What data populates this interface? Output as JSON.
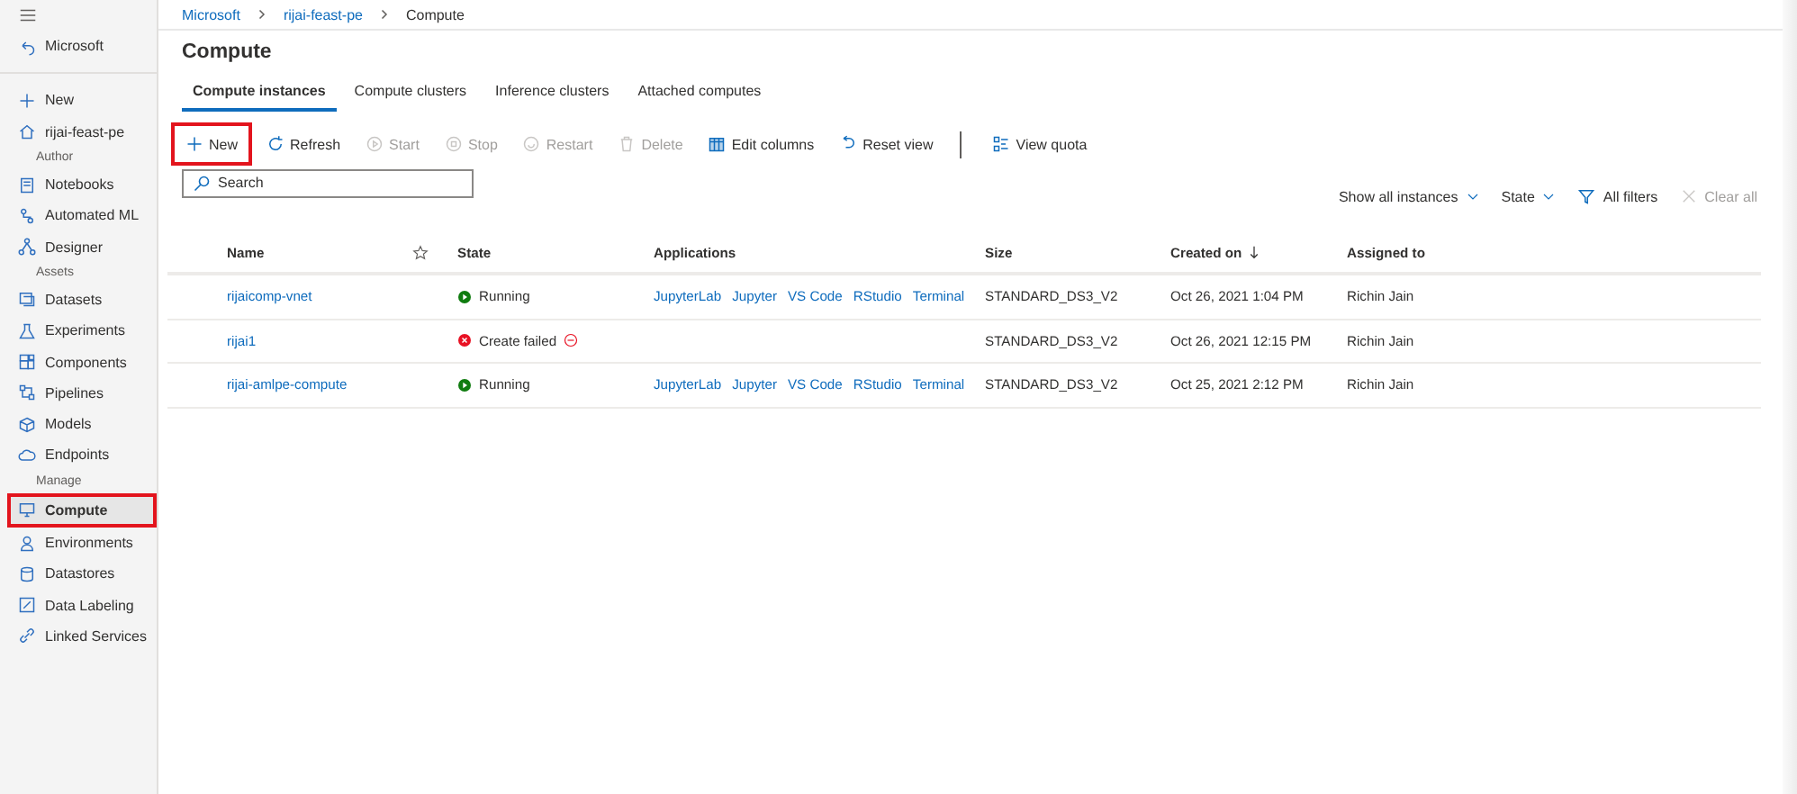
{
  "sidebar": {
    "back": "Microsoft",
    "items": [
      {
        "kind": "item",
        "label": "New",
        "selected": false,
        "highlighted": false
      },
      {
        "kind": "item",
        "label": "rijai-feast-pe",
        "selected": false,
        "highlighted": false
      },
      {
        "kind": "section",
        "label": "Author"
      },
      {
        "kind": "item",
        "label": "Notebooks",
        "selected": false,
        "highlighted": false
      },
      {
        "kind": "item",
        "label": "Automated ML",
        "selected": false,
        "highlighted": false
      },
      {
        "kind": "item",
        "label": "Designer",
        "selected": false,
        "highlighted": false
      },
      {
        "kind": "section",
        "label": "Assets"
      },
      {
        "kind": "item",
        "label": "Datasets",
        "selected": false,
        "highlighted": false
      },
      {
        "kind": "item",
        "label": "Experiments",
        "selected": false,
        "highlighted": false
      },
      {
        "kind": "item",
        "label": "Components",
        "selected": false,
        "highlighted": false
      },
      {
        "kind": "item",
        "label": "Pipelines",
        "selected": false,
        "highlighted": false
      },
      {
        "kind": "item",
        "label": "Models",
        "selected": false,
        "highlighted": false
      },
      {
        "kind": "item",
        "label": "Endpoints",
        "selected": false,
        "highlighted": false
      },
      {
        "kind": "section",
        "label": "Manage"
      },
      {
        "kind": "item",
        "label": "Compute",
        "selected": true,
        "highlighted": true
      },
      {
        "kind": "item",
        "label": "Environments",
        "selected": false,
        "highlighted": false
      },
      {
        "kind": "item",
        "label": "Datastores",
        "selected": false,
        "highlighted": false
      },
      {
        "kind": "item",
        "label": "Data Labeling",
        "selected": false,
        "highlighted": false
      },
      {
        "kind": "item",
        "label": "Linked Services",
        "selected": false,
        "highlighted": false
      }
    ]
  },
  "breadcrumb": [
    "Microsoft",
    "rijai-feast-pe",
    "Compute"
  ],
  "title": "Compute",
  "tabs": [
    {
      "label": "Compute instances",
      "selected": true
    },
    {
      "label": "Compute clusters",
      "selected": false
    },
    {
      "label": "Inference clusters",
      "selected": false
    },
    {
      "label": "Attached computes",
      "selected": false
    }
  ],
  "toolbar": [
    {
      "label": "New",
      "disabled": false,
      "highlighted": true
    },
    {
      "label": "Refresh",
      "disabled": false,
      "highlighted": false
    },
    {
      "label": "Start",
      "disabled": true,
      "highlighted": false
    },
    {
      "label": "Stop",
      "disabled": true,
      "highlighted": false
    },
    {
      "label": "Restart",
      "disabled": true,
      "highlighted": false
    },
    {
      "label": "Delete",
      "disabled": true,
      "highlighted": false
    },
    {
      "label": "Edit columns",
      "disabled": false,
      "highlighted": false
    },
    {
      "label": "Reset view",
      "disabled": false,
      "highlighted": false
    },
    {
      "label": "View quota",
      "disabled": false,
      "highlighted": false
    }
  ],
  "search": {
    "placeholder": "Search"
  },
  "filters": [
    {
      "label": "Show all instances",
      "kind": "dropdown",
      "disabled": false
    },
    {
      "label": "State",
      "kind": "dropdown",
      "disabled": false
    },
    {
      "label": "All filters",
      "kind": "filter",
      "disabled": false
    },
    {
      "label": "Clear all",
      "kind": "clear",
      "disabled": true
    }
  ],
  "table": {
    "columns": [
      "Name",
      "State",
      "Applications",
      "Size",
      "Created on",
      "Assigned to"
    ],
    "rows": [
      {
        "name": "rijaicomp-vnet",
        "state": "Running",
        "kind": "running",
        "applications": [
          "JupyterLab",
          "Jupyter",
          "VS Code",
          "RStudio",
          "Terminal"
        ],
        "size": "STANDARD_DS3_V2",
        "created": "Oct 26, 2021 1:04 PM",
        "assigned": "Richin Jain"
      },
      {
        "name": "rijai1",
        "state": "Create failed",
        "kind": "failed",
        "applications": [],
        "size": "STANDARD_DS3_V2",
        "created": "Oct 26, 2021 12:15 PM",
        "assigned": "Richin Jain"
      },
      {
        "name": "rijai-amlpe-compute",
        "state": "Running",
        "kind": "running",
        "applications": [
          "JupyterLab",
          "Jupyter",
          "VS Code",
          "RStudio",
          "Terminal"
        ],
        "size": "STANDARD_DS3_V2",
        "created": "Oct 25, 2021 2:12 PM",
        "assigned": "Richin Jain"
      }
    ]
  }
}
